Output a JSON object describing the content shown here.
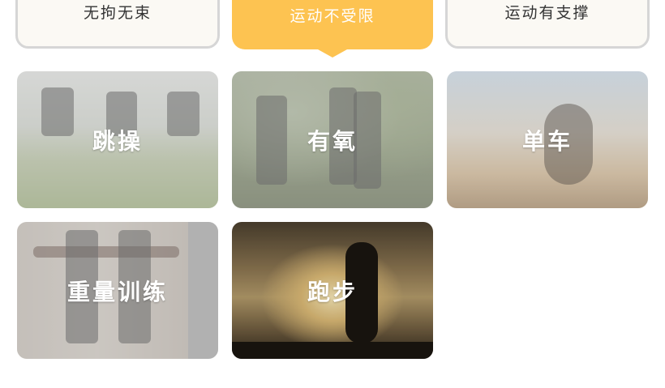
{
  "tabs": [
    {
      "label": "无拘无束",
      "active": false
    },
    {
      "label": "运动不受限",
      "active": true
    },
    {
      "label": "运动有支撑",
      "active": false
    }
  ],
  "cards": [
    {
      "label": "跳操",
      "icon": "aerobics-photo"
    },
    {
      "label": "有氧",
      "icon": "jogging-group-photo"
    },
    {
      "label": "单车",
      "icon": "bmx-bike-photo"
    },
    {
      "label": "重量训练",
      "icon": "weight-training-photo"
    },
    {
      "label": "跑步",
      "icon": "running-sunset-photo"
    }
  ],
  "colors": {
    "accent": "#fdc351",
    "tab_bg": "#fbf9f4",
    "tab_border": "#d6d6d6"
  }
}
